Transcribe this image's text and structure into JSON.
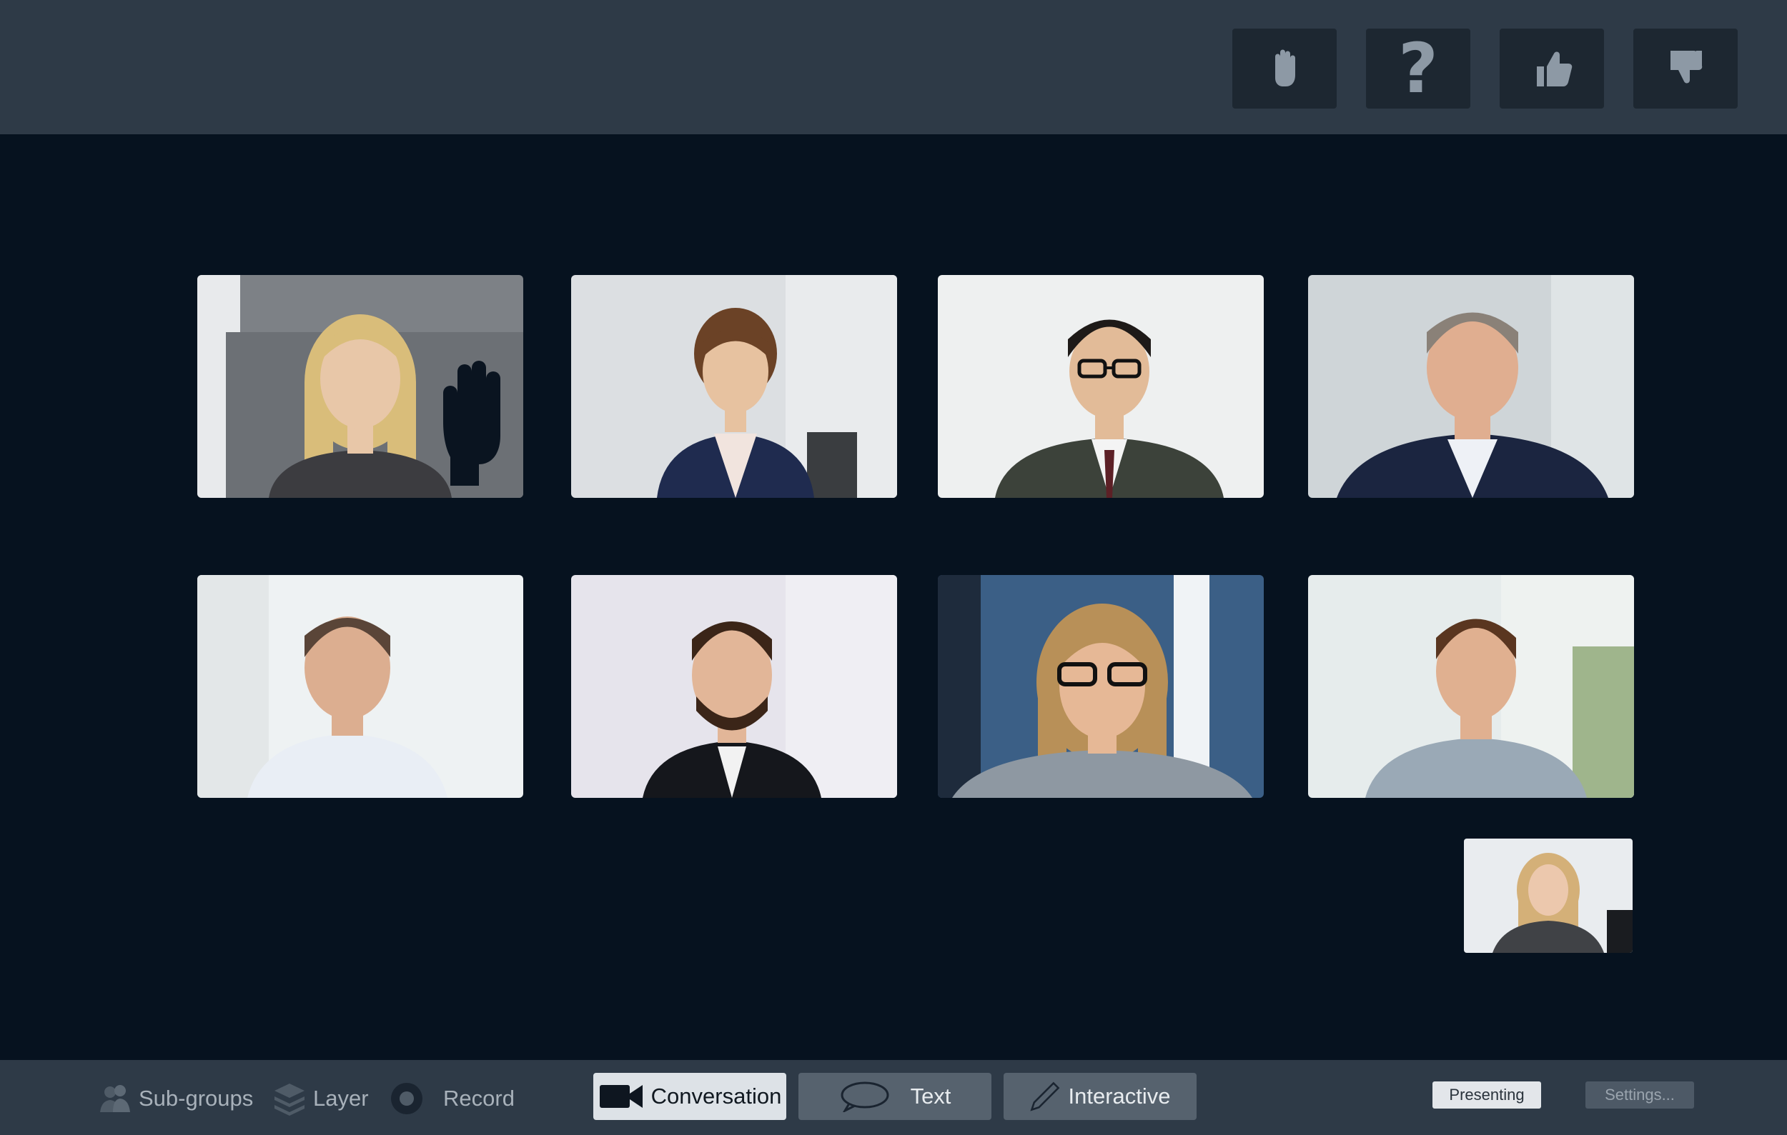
{
  "reactions": [
    {
      "name": "raise-hand",
      "icon": "hand-icon"
    },
    {
      "name": "question",
      "icon": "question-mark-icon",
      "label": "?"
    },
    {
      "name": "thumbs-up",
      "icon": "thumbs-up-icon"
    },
    {
      "name": "thumbs-down",
      "icon": "thumbs-down-icon"
    }
  ],
  "participants": [
    {
      "id": "p1",
      "hand_raised": true,
      "skin": "#e8c7a8",
      "hair": "#d9bd7a",
      "shirt": "#3c3c40",
      "bg": "#8c9094"
    },
    {
      "id": "p2",
      "hand_raised": false,
      "skin": "#e7c2a0",
      "hair": "#6b4226",
      "shirt": "#1f2b4f",
      "bg": "#dcdfe2"
    },
    {
      "id": "p3",
      "hand_raised": false,
      "skin": "#e2bb98",
      "hair": "#1e1a18",
      "shirt": "#3c423a",
      "bg": "#eef0f0"
    },
    {
      "id": "p4",
      "hand_raised": false,
      "skin": "#e0ae90",
      "hair": "#8a8178",
      "shirt": "#1b2540",
      "bg": "#cfd5d8"
    },
    {
      "id": "p5",
      "hand_raised": false,
      "skin": "#dcae90",
      "hair": "#5a4538",
      "shirt": "#e9eef5",
      "bg": "#eef2f3"
    },
    {
      "id": "p6",
      "hand_raised": false,
      "skin": "#e2b698",
      "hair": "#3b2518",
      "shirt": "#15171c",
      "bg": "#e6e4ec"
    },
    {
      "id": "p7",
      "hand_raised": false,
      "skin": "#e6b896",
      "hair": "#b89058",
      "shirt": "#8e98a2",
      "bg": "#3b5f86"
    },
    {
      "id": "p8",
      "hand_raised": false,
      "skin": "#e0b090",
      "hair": "#5a3620",
      "shirt": "#9aa9b6",
      "bg": "#e6ecec"
    }
  ],
  "self_view": {
    "skin": "#ecc8ad",
    "hair": "#d4b078",
    "shirt": "#404246",
    "bg": "#e9ecef"
  },
  "toolbar": {
    "subgroups_label": "Sub-groups",
    "layer_label": "Layer",
    "record_label": "Record",
    "conversation_label": "Conversation",
    "text_label": "Text",
    "interactive_label": "Interactive",
    "presenting_label": "Presenting",
    "settings_label": "Settings..."
  },
  "colors": {
    "topbar": "#2e3a47",
    "stage": "#06121f",
    "active_mode": "#dde2e7",
    "icon_gray": "#8d99a5"
  }
}
